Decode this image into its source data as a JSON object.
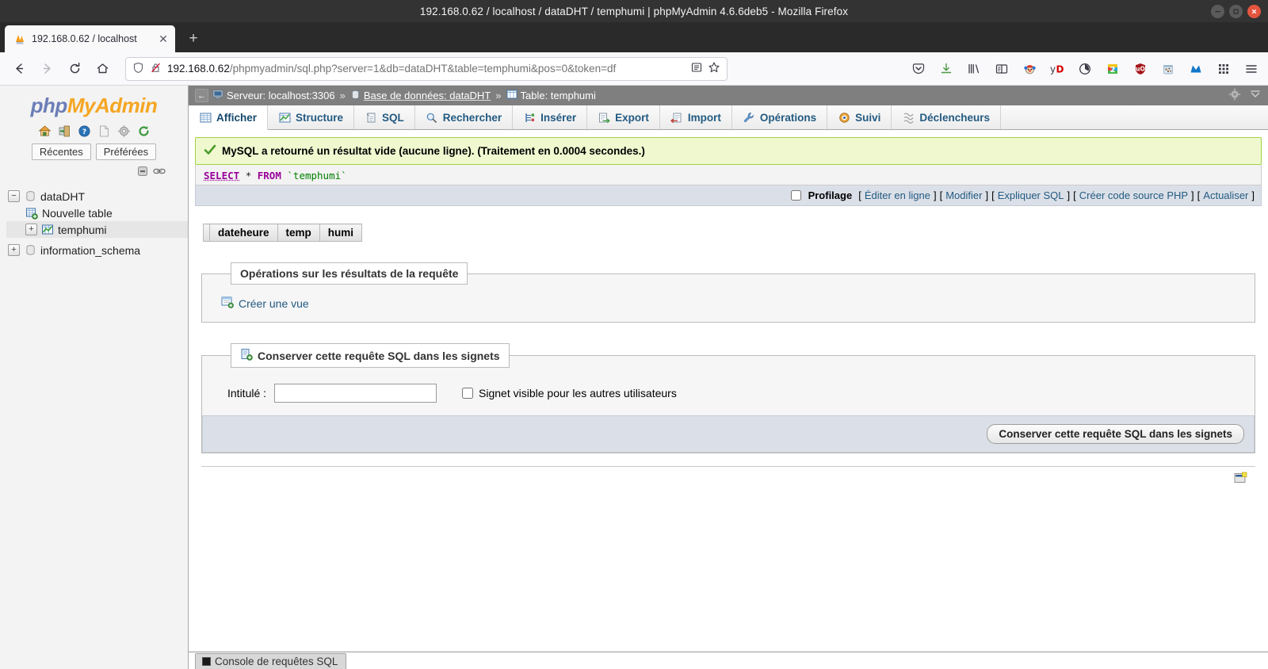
{
  "window": {
    "title": "192.168.0.62 / localhost / dataDHT / temphumi | phpMyAdmin 4.6.6deb5 - Mozilla Firefox",
    "minimize_label": "–",
    "maximize_label": "□",
    "close_label": "✕"
  },
  "browser": {
    "tab": {
      "title": "192.168.0.62 / localhost",
      "favicon": "phpmyadmin-favicon",
      "close_label": "✕"
    },
    "newtab_label": "+",
    "nav": {
      "back_label": "←",
      "forward_label": "→",
      "reload_label": "↻",
      "home_label": "⌂"
    },
    "url": {
      "host": "192.168.0.62",
      "path": "/phpmyadmin/sql.php?server=1&db=dataDHT&table=temphumi&pos=0&token=df",
      "shield_icon": "shield-icon",
      "insecure_icon": "lock-crossed-icon",
      "reader_icon": "reader-view-icon",
      "bookmark_icon": "star-icon"
    },
    "toolbar_icons": [
      {
        "name": "pocket-icon",
        "glyph": "♡"
      },
      {
        "name": "downloads-icon",
        "glyph": "↓"
      },
      {
        "name": "library-icon",
        "glyph": "‖∖"
      },
      {
        "name": "sidebar-icon",
        "glyph": "▤"
      },
      {
        "name": "extension-clown-icon",
        "glyph": "●"
      },
      {
        "name": "extension-yd-icon",
        "glyph": "yD"
      },
      {
        "name": "extension-circle-icon",
        "glyph": "◔"
      },
      {
        "name": "extension-2-icon",
        "glyph": "2"
      },
      {
        "name": "extension-ublock-icon",
        "glyph": "Ⓤ"
      },
      {
        "name": "extension-cookie-icon",
        "glyph": "●"
      },
      {
        "name": "extension-malwarebytes-icon",
        "glyph": "M"
      },
      {
        "name": "app-grid-icon",
        "glyph": "⋮⋮"
      },
      {
        "name": "menu-hamburger-icon",
        "glyph": "≡"
      }
    ]
  },
  "pma": {
    "logo": {
      "php": "php",
      "my": "My",
      "admin": "Admin"
    },
    "nav_icons": [
      {
        "name": "home-icon",
        "title": "Accueil"
      },
      {
        "name": "logout-icon",
        "title": "Quitter"
      },
      {
        "name": "help-icon",
        "title": "Aide"
      },
      {
        "name": "docs-icon",
        "title": "Documentation"
      },
      {
        "name": "settings-gear-icon",
        "title": "Paramètres"
      },
      {
        "name": "reload-icon",
        "title": "Recharger"
      }
    ],
    "nav_tabs": [
      {
        "label": "Récentes"
      },
      {
        "label": "Préférées"
      }
    ],
    "nav_controls": [
      {
        "name": "collapse-all-icon"
      },
      {
        "name": "link-with-main-panel-icon"
      }
    ],
    "tree": [
      {
        "label": "dataDHT",
        "icon": "database-icon",
        "expander": "−",
        "level": 0,
        "selected": false
      },
      {
        "label": "Nouvelle table",
        "icon": "new-table-icon",
        "expander": "",
        "level": 1,
        "selected": false
      },
      {
        "label": "temphumi",
        "icon": "table-chart-icon",
        "expander": "+",
        "level": 1,
        "selected": true
      },
      {
        "label": "information_schema",
        "icon": "database-icon",
        "expander": "+",
        "level": 0,
        "selected": false
      }
    ]
  },
  "breadcrumb": {
    "back_label": "←",
    "server": {
      "icon": "server-icon",
      "label": "Serveur: localhost:3306"
    },
    "database": {
      "icon": "database-icon",
      "label": "Base de données: dataDHT"
    },
    "table": {
      "icon": "table-icon",
      "label": "Table: temphumi"
    },
    "separator": "»",
    "settings_icon": "gear-icon",
    "collapse_icon": "collapse-icon"
  },
  "tabs": [
    {
      "label": "Afficher",
      "icon": "browse-icon",
      "active": true
    },
    {
      "label": "Structure",
      "icon": "structure-icon",
      "active": false
    },
    {
      "label": "SQL",
      "icon": "sql-icon",
      "active": false
    },
    {
      "label": "Rechercher",
      "icon": "search-icon",
      "active": false
    },
    {
      "label": "Insérer",
      "icon": "insert-icon",
      "active": false
    },
    {
      "label": "Export",
      "icon": "export-icon",
      "active": false
    },
    {
      "label": "Import",
      "icon": "import-icon",
      "active": false
    },
    {
      "label": "Opérations",
      "icon": "wrench-icon",
      "active": false
    },
    {
      "label": "Suivi",
      "icon": "tracking-icon",
      "active": false
    },
    {
      "label": "Déclencheurs",
      "icon": "triggers-icon",
      "active": false
    }
  ],
  "result": {
    "status_icon": "check-icon",
    "message": "MySQL a retourné un résultat vide (aucune ligne). (Traitement en 0.0004 secondes.)",
    "sql": {
      "select": "SELECT",
      "star": "*",
      "from": "FROM",
      "table": "`temphumi`"
    }
  },
  "query_toolbar": {
    "profiling_label": "Profilage",
    "profiling_checked": false,
    "links": [
      {
        "label": "Éditer en ligne"
      },
      {
        "label": "Modifier"
      },
      {
        "label": "Expliquer SQL"
      },
      {
        "label": "Créer code source PHP"
      },
      {
        "label": "Actualiser"
      }
    ],
    "open_bracket": "[",
    "close_bracket": "]"
  },
  "results_table": {
    "columns": [
      "dateheure",
      "temp",
      "humi"
    ],
    "rows": []
  },
  "query_operations": {
    "legend": "Opérations sur les résultats de la requête",
    "create_view": {
      "label": "Créer une vue",
      "icon": "create-view-icon"
    }
  },
  "bookmark": {
    "legend": "Conserver cette requête SQL dans les signets",
    "legend_icon": "bookmark-icon",
    "label_caption": "Intitulé :",
    "label_value": "",
    "label_placeholder": "",
    "visible_checkbox_label": "Signet visible pour les autres utilisateurs",
    "visible_checked": false,
    "submit_label": "Conserver cette requête SQL dans les signets"
  },
  "footer": {
    "floating_icon": "query-window-icon",
    "console_label": "Console de requêtes SQL",
    "console_icon": "console-square-icon"
  }
}
